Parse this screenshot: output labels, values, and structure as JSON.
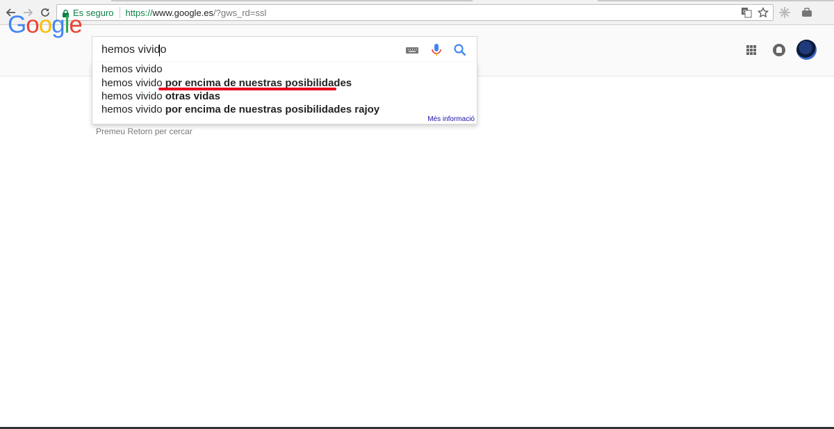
{
  "browser": {
    "secure_label": "Es seguro",
    "url_scheme": "https://",
    "url_host": "www.google.es",
    "url_rest": "/?gws_rd=ssl"
  },
  "google": {
    "logo": [
      "G",
      "o",
      "o",
      "g",
      "l",
      "e"
    ],
    "search_value": "hemos vivido",
    "suggestions": [
      {
        "prefix": "hemos vivido",
        "bold": ""
      },
      {
        "prefix": "hemos vivido ",
        "bold": "por encima de nuestras posibilidades"
      },
      {
        "prefix": "hemos vivido ",
        "bold": "otras vidas"
      },
      {
        "prefix": "hemos vivido ",
        "bold": "por encima de nuestras posibilidades rajoy"
      }
    ],
    "more_info": "Més informació",
    "hint": "Premeu Retorn per cercar"
  },
  "colors": {
    "accent_blue": "#4285f4",
    "accent_red": "#ea4335",
    "accent_yellow": "#fbbc05",
    "accent_green": "#34a853",
    "secure_green": "#0b8043",
    "annotation_red": "#e8001c"
  }
}
